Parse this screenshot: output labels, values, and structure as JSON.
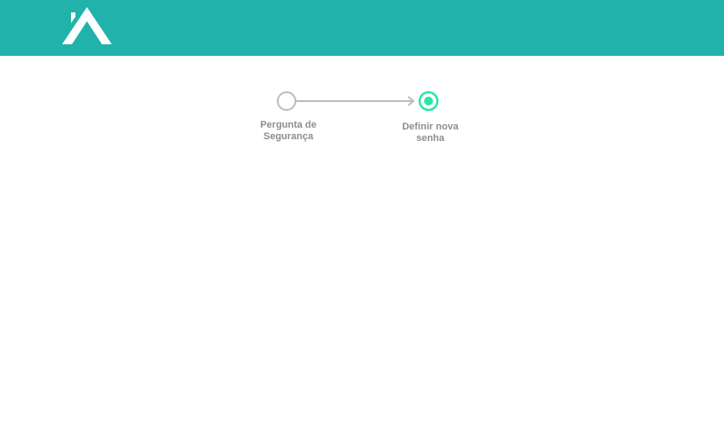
{
  "header": {
    "logo_icon": "roof-a-logo-icon",
    "background_color": "#21b3ab"
  },
  "stepper": {
    "steps": [
      {
        "label_line1": "Pergunta de",
        "label_line2": "Segurança",
        "state": "inactive",
        "icon": "empty-circle-icon"
      },
      {
        "label_line1": "Definir nova",
        "label_line2": "senha",
        "state": "active",
        "icon": "active-dot-circle-icon"
      }
    ],
    "connector_icon": "arrow-right-icon",
    "active_color": "#2ee5a6",
    "inactive_color": "#bdbdbd"
  }
}
